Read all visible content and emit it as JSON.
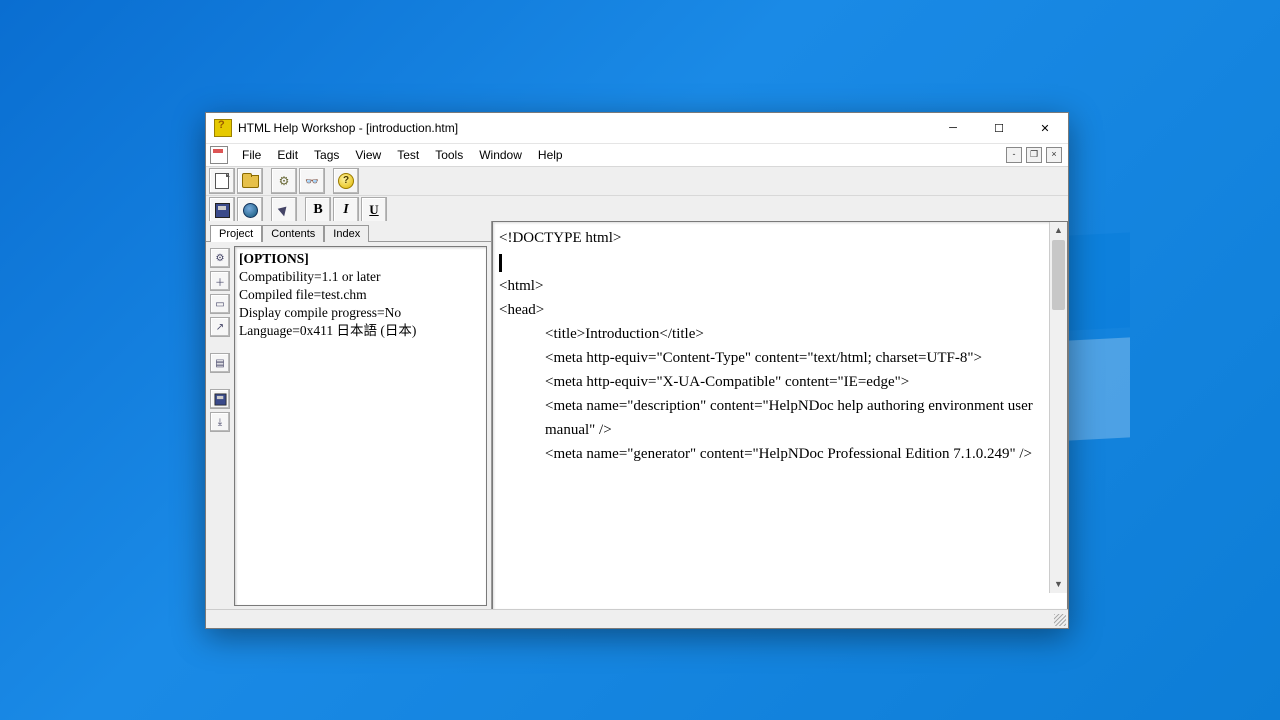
{
  "window": {
    "title": "HTML Help Workshop - [introduction.htm]"
  },
  "menu": {
    "file": "File",
    "edit": "Edit",
    "tags": "Tags",
    "view": "View",
    "test": "Test",
    "tools": "Tools",
    "window": "Window",
    "help": "Help"
  },
  "left": {
    "tabs": {
      "project": "Project",
      "contents": "Contents",
      "index": "Index"
    },
    "options_header": "[OPTIONS]",
    "lines": {
      "l1": "Compatibility=1.1 or later",
      "l2": "Compiled file=test.chm",
      "l3": "Display compile progress=No",
      "l4": "Language=0x411 日本語 (日本)"
    }
  },
  "editor": {
    "l1": "<!DOCTYPE html>",
    "l2": "",
    "l3": "<html>",
    "l4": "",
    "l5": "<head>",
    "l6": "<title>Introduction</title>",
    "l7": "<meta http-equiv=\"Content-Type\" content=\"text/html; charset=UTF-8\">",
    "l8": "<meta http-equiv=\"X-UA-Compatible\" content=\"IE=edge\">",
    "l9": "<meta name=\"description\" content=\"HelpNDoc help authoring environment user manual\" />",
    "l10": "<meta name=\"generator\" content=\"HelpNDoc Professional Edition 7.1.0.249\" />"
  },
  "toolbar2": {
    "b": "B",
    "i": "I",
    "u": "U"
  }
}
